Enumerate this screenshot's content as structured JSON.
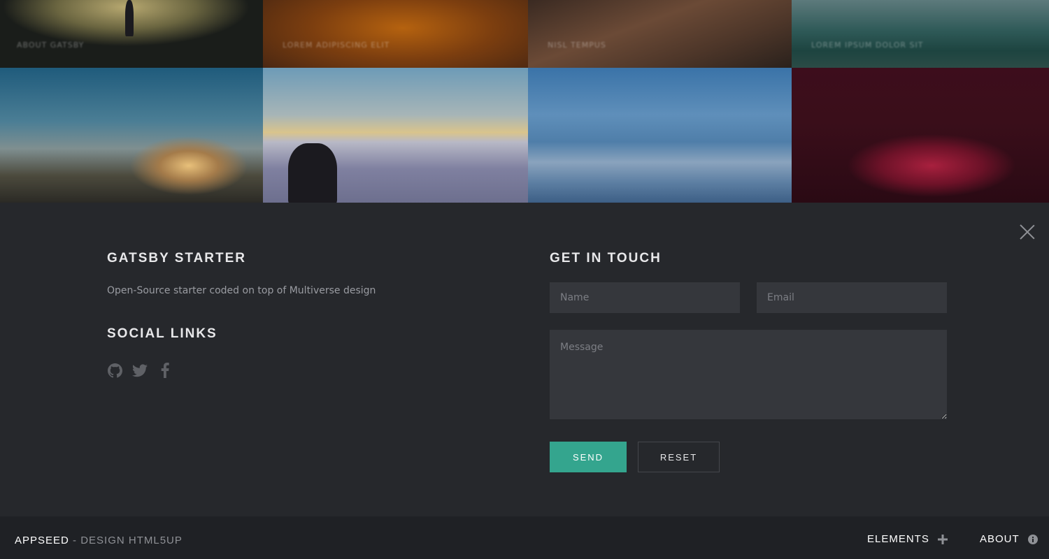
{
  "gallery": {
    "tiles": [
      {
        "caption": "About Gatsby"
      },
      {
        "caption": "Lorem Adipiscing Elit"
      },
      {
        "caption": "Nisl Tempus"
      },
      {
        "caption": "Lorem Ipsum Dolor Sit"
      },
      {
        "caption": ""
      },
      {
        "caption": ""
      },
      {
        "caption": ""
      },
      {
        "caption": ""
      }
    ]
  },
  "panel": {
    "left": {
      "title": "GATSBY STARTER",
      "description": "Open-Source starter coded on top of Multiverse design",
      "social_title": "SOCIAL LINKS",
      "social_icons": [
        "github-icon",
        "twitter-icon",
        "facebook-icon"
      ]
    },
    "contact": {
      "title": "GET IN TOUCH",
      "name_placeholder": "Name",
      "email_placeholder": "Email",
      "message_placeholder": "Message",
      "send_label": "SEND",
      "reset_label": "RESET"
    }
  },
  "footer": {
    "brand_name": "APPSEED",
    "brand_sub": " - DESIGN HTML5UP",
    "elements_label": "ELEMENTS",
    "about_label": "ABOUT"
  },
  "colors": {
    "accent": "#34a58e",
    "panel_bg": "#26282c",
    "footer_bg": "#1f2125"
  }
}
